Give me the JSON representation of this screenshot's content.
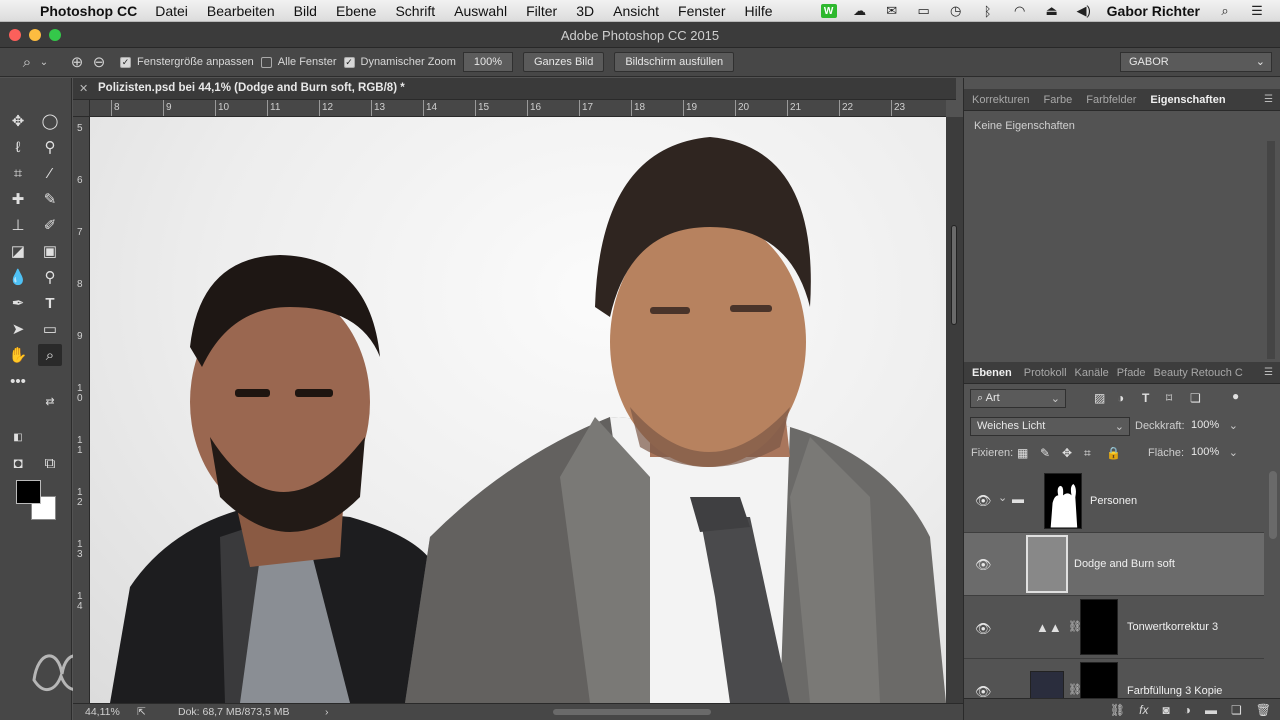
{
  "menubar": {
    "app_name": "Photoshop CC",
    "items": [
      "Datei",
      "Bearbeiten",
      "Bild",
      "Ebene",
      "Schrift",
      "Auswahl",
      "Filter",
      "3D",
      "Ansicht",
      "Fenster",
      "Hilfe"
    ],
    "user_name": "Gabor Richter",
    "status_icons": [
      "wacom-icon",
      "cloud-icon",
      "message-icon",
      "display-icon",
      "time-machine-icon",
      "bluetooth-icon",
      "wifi-icon",
      "eject-icon",
      "volume-icon"
    ]
  },
  "window": {
    "title": "Adobe Photoshop CC 2015"
  },
  "options_bar": {
    "fit_window_label": "Fenstergröße anpassen",
    "fit_window_checked": true,
    "all_windows_label": "Alle Fenster",
    "all_windows_checked": false,
    "scrubby_zoom_label": "Dynamischer Zoom",
    "scrubby_zoom_checked": true,
    "zoom_value": "100%",
    "fit_screen_label": "Ganzes Bild",
    "fill_screen_label": "Bildschirm ausfüllen",
    "workspace": "GABOR"
  },
  "document": {
    "tab_title": "Polizisten.psd bei 44,1% (Dodge and Burn soft, RGB/8) *",
    "ruler_h_labels": [
      "8",
      "9",
      "10",
      "11",
      "12",
      "13",
      "14",
      "15",
      "16",
      "17",
      "18",
      "19",
      "20",
      "21",
      "22",
      "23"
    ],
    "ruler_v_labels": [
      "5",
      "6",
      "7",
      "8",
      "9",
      "1\n0",
      "1\n1",
      "1\n2",
      "1\n3",
      "1\n4"
    ]
  },
  "status_bar": {
    "zoom": "44,11%",
    "doc_size": "Dok: 68,7 MB/873,5 MB"
  },
  "properties_panel": {
    "tabs": [
      "Korrekturen",
      "Farbe",
      "Farbfelder",
      "Eigenschaften"
    ],
    "active_tab": "Eigenschaften",
    "message": "Keine Eigenschaften"
  },
  "layers_panel": {
    "tabs": [
      "Ebenen",
      "Protokoll",
      "Kanäle",
      "Pfade",
      "Beauty Retouch C"
    ],
    "active_tab": "Ebenen",
    "filter_kind": "Art",
    "blend_mode": "Weiches Licht",
    "opacity_label": "Deckkraft:",
    "opacity_value": "100%",
    "lock_label": "Fixieren:",
    "fill_label": "Fläche:",
    "fill_value": "100%",
    "layers": [
      {
        "name": "Personen",
        "type": "group",
        "visible": true,
        "selected": false
      },
      {
        "name": "Dodge and Burn soft",
        "type": "pixel",
        "visible": true,
        "selected": true
      },
      {
        "name": "Tonwertkorrektur 3",
        "type": "adjustment",
        "visible": true,
        "selected": false
      },
      {
        "name": "Farbfüllung 3 Kopie",
        "type": "fill",
        "visible": true,
        "selected": false
      }
    ]
  },
  "colors": {
    "foreground": "#000000",
    "background": "#ffffff"
  }
}
